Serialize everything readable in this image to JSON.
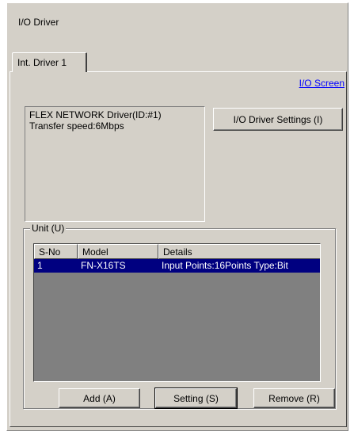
{
  "window": {
    "title": "I/O Driver"
  },
  "tabs": [
    {
      "label": "Int. Driver 1",
      "active": true
    }
  ],
  "link": {
    "label": "I/O Screen"
  },
  "driver_info": {
    "line1": "FLEX NETWORK Driver(ID:#1)",
    "line2": "Transfer speed:6Mbps"
  },
  "buttons": {
    "driver_settings": "I/O Driver Settings (I)",
    "add": "Add (A)",
    "setting": "Setting (S)",
    "remove": "Remove (R)"
  },
  "unit_group": {
    "label": "Unit (U)",
    "columns": [
      "S-No",
      "Model",
      "Details"
    ],
    "rows": [
      {
        "sno": "1",
        "model": "FN-X16TS",
        "details": "Input Points:16Points Type:Bit",
        "selected": true
      }
    ]
  },
  "colors": {
    "dialog_bg": "#d4d0c8",
    "selection": "#000080",
    "link": "#0000ff",
    "list_bg": "#808080"
  }
}
